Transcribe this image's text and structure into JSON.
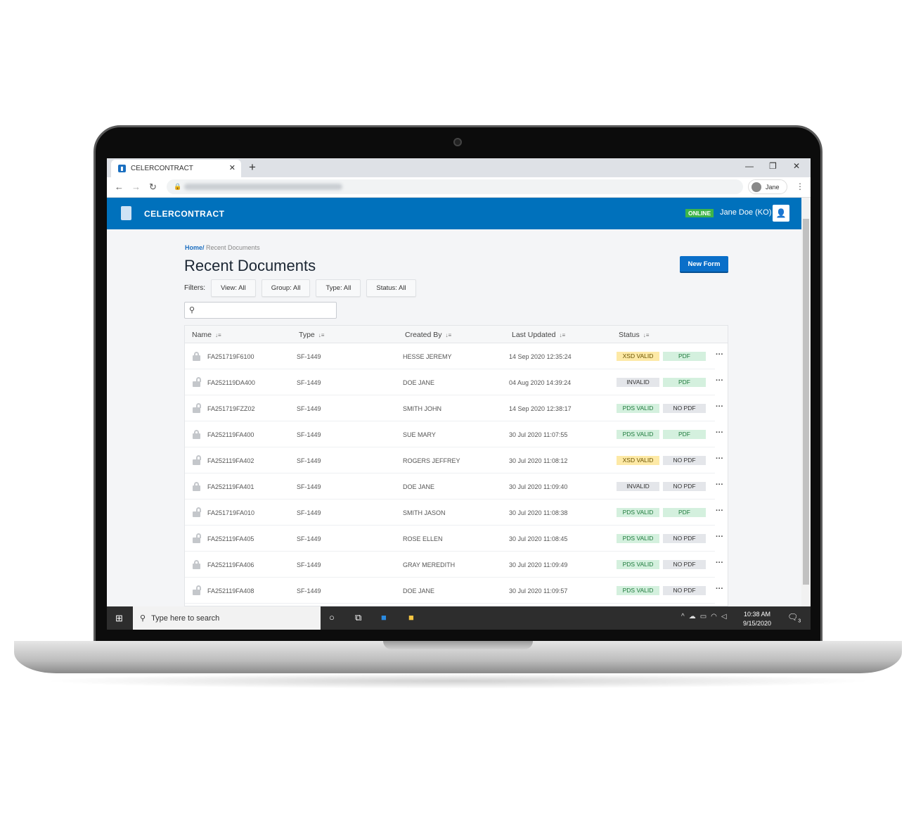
{
  "browser": {
    "tab_title": "CELERCONTRACT",
    "profile": "Jane"
  },
  "app": {
    "name": "CELERCONTRACT",
    "status": "ONLINE",
    "user": "Jane Doe (KO)",
    "brand_color": "#0071bc"
  },
  "breadcrumb": {
    "home": "Home/",
    "current": "Recent Documents"
  },
  "page": {
    "title": "Recent Documents",
    "new_form": "New Form"
  },
  "filters": {
    "label": "Filters:",
    "items": [
      "View: All",
      "Group: All",
      "Type: All",
      "Status: All"
    ]
  },
  "search": {
    "placeholder": ""
  },
  "table": {
    "columns": [
      "Name",
      "Type",
      "Created By",
      "Last Updated",
      "Status"
    ],
    "rows": [
      {
        "name": "FA251719F6100",
        "type": "SF-1449",
        "created_by": "HESSE JEREMY",
        "updated": "14 Sep 2020 12:35:24",
        "status": "XSD VALID",
        "pdf": "PDF",
        "locked": true
      },
      {
        "name": "FA252119DA400",
        "type": "SF-1449",
        "created_by": "DOE JANE",
        "updated": "04 Aug 2020 14:39:24",
        "status": "INVALID",
        "pdf": "PDF",
        "locked": false
      },
      {
        "name": "FA251719FZZ02",
        "type": "SF-1449",
        "created_by": "SMITH JOHN",
        "updated": "14 Sep 2020 12:38:17",
        "status": "PDS VALID",
        "pdf": "NO PDF",
        "locked": false
      },
      {
        "name": "FA252119FA400",
        "type": "SF-1449",
        "created_by": "SUE MARY",
        "updated": "30 Jul 2020 11:07:55",
        "status": "PDS VALID",
        "pdf": "PDF",
        "locked": true
      },
      {
        "name": "FA252119FA402",
        "type": "SF-1449",
        "created_by": "ROGERS JEFFREY",
        "updated": "30 Jul 2020 11:08:12",
        "status": "XSD VALID",
        "pdf": "NO PDF",
        "locked": false
      },
      {
        "name": "FA252119FA401",
        "type": "SF-1449",
        "created_by": "DOE JANE",
        "updated": "30 Jul 2020 11:09:40",
        "status": "INVALID",
        "pdf": "NO PDF",
        "locked": true
      },
      {
        "name": "FA251719FA010",
        "type": "SF-1449",
        "created_by": "SMITH JASON",
        "updated": "30 Jul 2020 11:08:38",
        "status": "PDS VALID",
        "pdf": "PDF",
        "locked": false
      },
      {
        "name": "FA252119FA405",
        "type": "SF-1449",
        "created_by": "ROSE ELLEN",
        "updated": "30 Jul 2020 11:08:45",
        "status": "PDS VALID",
        "pdf": "NO PDF",
        "locked": false
      },
      {
        "name": "FA252119FA406",
        "type": "SF-1449",
        "created_by": "GRAY MEREDITH",
        "updated": "30 Jul 2020 11:09:49",
        "status": "PDS VALID",
        "pdf": "NO PDF",
        "locked": true
      },
      {
        "name": "FA252119FA408",
        "type": "SF-1449",
        "created_by": "DOE JANE",
        "updated": "30 Jul 2020 11:09:57",
        "status": "PDS VALID",
        "pdf": "NO PDF",
        "locked": false
      }
    ]
  },
  "badge_colors": {
    "XSD VALID": [
      "#fde9a6",
      "#6b5300"
    ],
    "INVALID": [
      "#e4e6ea",
      "#333"
    ],
    "PDS VALID": [
      "#d4f0de",
      "#1e7a3c"
    ],
    "PDF": [
      "#d4f0de",
      "#1e7a3c"
    ],
    "NO PDF": [
      "#e4e6ea",
      "#333"
    ]
  },
  "taskbar": {
    "search": "Type here to search",
    "time": "10:38 AM",
    "date": "9/15/2020",
    "notifications": "3"
  }
}
